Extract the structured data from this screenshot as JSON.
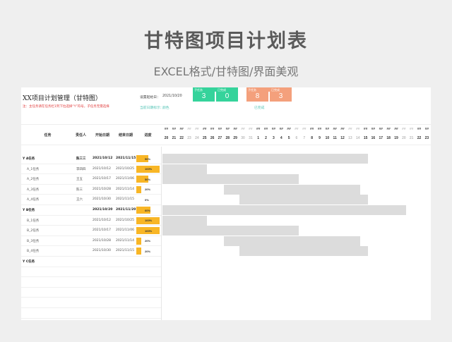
{
  "promo": {
    "title": "甘特图项目计划表",
    "subtitle": "EXCEL格式/甘特图/界面美观"
  },
  "sheet": {
    "title": "XX项目计划管理（甘特图）",
    "warning": "注：主任务请在任务栏1列下拉选择“Y”符号，子任务无需选择",
    "start_label": "设置起始日：",
    "start_value": "2021/10/20",
    "today_label": "当前日期标示：",
    "today_value": "颜色",
    "done_label": "已完成",
    "cards": [
      {
        "header_left": "子任务",
        "header_right": "已完成",
        "left": "3",
        "right": "0",
        "color": "#35d39b"
      },
      {
        "header_left": "子任务",
        "header_right": "已完成",
        "left": "8",
        "right": "3",
        "color": "#f4a07c"
      }
    ],
    "columns": [
      "任务",
      "责任人",
      "开始日期",
      "结束日期",
      "进度"
    ],
    "days": [
      "20",
      "21",
      "22",
      "23",
      "24",
      "25",
      "26",
      "27",
      "28",
      "29",
      "30",
      "31",
      "1",
      "2",
      "3",
      "4",
      "5",
      "6",
      "7",
      "8",
      "9",
      "10",
      "11",
      "12",
      "13",
      "14",
      "15",
      "16",
      "17",
      "18",
      "19",
      "20",
      "21",
      "22",
      "23"
    ],
    "weekend": [
      3,
      4,
      10,
      11,
      17,
      18,
      24,
      25,
      31,
      32
    ],
    "day_header": "##",
    "rows": [
      {
        "task": "Y   A任务",
        "owner": "陈三三",
        "start": "2021/10/12",
        "end": "2021/11/15",
        "progress": "50%",
        "pct": 0.5,
        "main": true
      },
      {
        "task": "A_1任务",
        "owner": "李四四",
        "start": "2021/10/12",
        "end": "2021/10/25",
        "progress": "100%",
        "pct": 1.0,
        "main": false
      },
      {
        "task": "A_2任务",
        "owner": "王五",
        "start": "2021/10/17",
        "end": "2021/11/06",
        "progress": "50%",
        "pct": 0.5,
        "main": false
      },
      {
        "task": "A_3任务",
        "owner": "陈三",
        "start": "2021/10/28",
        "end": "2021/11/14",
        "progress": "20%",
        "pct": 0.2,
        "main": false
      },
      {
        "task": "A_4任务",
        "owner": "王六",
        "start": "2021/10/30",
        "end": "2021/11/15",
        "progress": "0%",
        "pct": 0.0,
        "main": false
      },
      {
        "task": "Y   B任务",
        "owner": "",
        "start": "2021/10/20",
        "end": "2021/11/20",
        "progress": "60%",
        "pct": 0.6,
        "main": true
      },
      {
        "task": "B_1任务",
        "owner": "",
        "start": "2021/10/12",
        "end": "2021/10/25",
        "progress": "100%",
        "pct": 1.0,
        "main": false
      },
      {
        "task": "B_2任务",
        "owner": "",
        "start": "2021/10/17",
        "end": "2021/11/06",
        "progress": "100%",
        "pct": 1.0,
        "main": false
      },
      {
        "task": "B_3任务",
        "owner": "",
        "start": "2021/10/28",
        "end": "2021/11/14",
        "progress": "20%",
        "pct": 0.2,
        "main": false
      },
      {
        "task": "B_4任务",
        "owner": "",
        "start": "2021/10/30",
        "end": "2021/11/15",
        "progress": "20%",
        "pct": 0.2,
        "main": false
      },
      {
        "task": "Y   C任务",
        "owner": "",
        "start": "",
        "end": "",
        "progress": "",
        "pct": null,
        "main": true
      }
    ],
    "gantt": [
      {
        "row": 0,
        "start": "2021/10/20",
        "end": "2021/11/15"
      },
      {
        "row": 1,
        "start": "2021/10/20",
        "end": "2021/10/25"
      },
      {
        "row": 2,
        "start": "2021/10/20",
        "end": "2021/11/06"
      },
      {
        "row": 3,
        "start": "2021/10/28",
        "end": "2021/11/14"
      },
      {
        "row": 4,
        "start": "2021/10/30",
        "end": "2021/11/15"
      },
      {
        "row": 5,
        "start": "2021/10/20",
        "end": "2021/11/20"
      },
      {
        "row": 6,
        "start": "2021/10/20",
        "end": "2021/10/25"
      },
      {
        "row": 7,
        "start": "2021/10/20",
        "end": "2021/11/06"
      },
      {
        "row": 8,
        "start": "2021/10/28",
        "end": "2021/11/14"
      },
      {
        "row": 9,
        "start": "2021/10/30",
        "end": "2021/11/15"
      }
    ]
  }
}
